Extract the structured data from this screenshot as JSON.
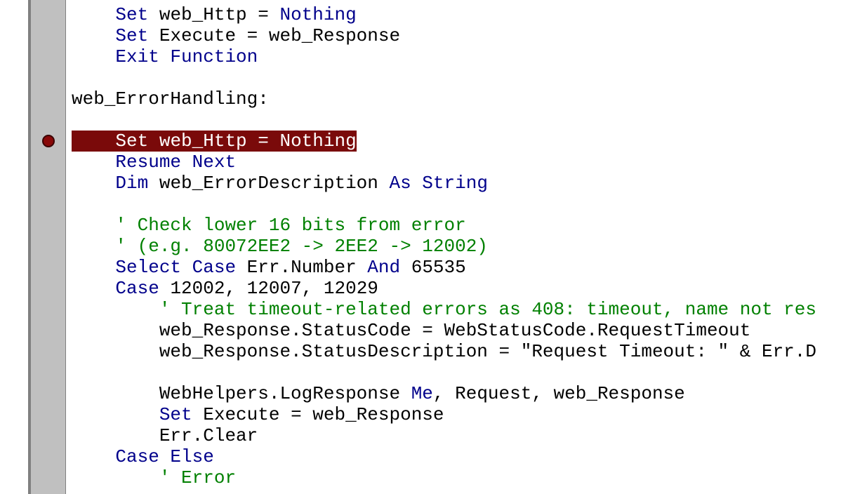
{
  "code": {
    "lines": [
      {
        "indent": 4,
        "highlighted": false,
        "tokens": [
          {
            "cls": "kw",
            "t": "Set"
          },
          {
            "cls": "plain",
            "t": " web_Http = "
          },
          {
            "cls": "kw",
            "t": "Nothing"
          }
        ]
      },
      {
        "indent": 4,
        "highlighted": false,
        "tokens": [
          {
            "cls": "kw",
            "t": "Set"
          },
          {
            "cls": "plain",
            "t": " Execute = web_Response"
          }
        ]
      },
      {
        "indent": 4,
        "highlighted": false,
        "tokens": [
          {
            "cls": "kw",
            "t": "Exit Function"
          }
        ]
      },
      {
        "indent": 0,
        "highlighted": false,
        "tokens": []
      },
      {
        "indent": 0,
        "highlighted": false,
        "tokens": [
          {
            "cls": "plain",
            "t": "web_ErrorHandling:"
          }
        ]
      },
      {
        "indent": 0,
        "highlighted": false,
        "tokens": []
      },
      {
        "indent": 0,
        "highlighted": true,
        "breakpoint": true,
        "tokens": [
          {
            "cls": "plain",
            "t": "    "
          },
          {
            "cls": "kw",
            "t": "Set"
          },
          {
            "cls": "plain",
            "t": " web_Http = "
          },
          {
            "cls": "kw",
            "t": "Nothing"
          }
        ]
      },
      {
        "indent": 4,
        "highlighted": false,
        "tokens": [
          {
            "cls": "kw",
            "t": "Resume"
          },
          {
            "cls": "plain",
            "t": " "
          },
          {
            "cls": "kw",
            "t": "Next"
          }
        ]
      },
      {
        "indent": 4,
        "highlighted": false,
        "tokens": [
          {
            "cls": "kw",
            "t": "Dim"
          },
          {
            "cls": "plain",
            "t": " web_ErrorDescription "
          },
          {
            "cls": "kw",
            "t": "As String"
          }
        ]
      },
      {
        "indent": 0,
        "highlighted": false,
        "tokens": []
      },
      {
        "indent": 4,
        "highlighted": false,
        "tokens": [
          {
            "cls": "cm",
            "t": "' Check lower 16 bits from error"
          }
        ]
      },
      {
        "indent": 4,
        "highlighted": false,
        "tokens": [
          {
            "cls": "cm",
            "t": "' (e.g. 80072EE2 -> 2EE2 -> 12002)"
          }
        ]
      },
      {
        "indent": 4,
        "highlighted": false,
        "tokens": [
          {
            "cls": "kw",
            "t": "Select Case"
          },
          {
            "cls": "plain",
            "t": " Err.Number "
          },
          {
            "cls": "kw",
            "t": "And"
          },
          {
            "cls": "plain",
            "t": " 65535"
          }
        ]
      },
      {
        "indent": 4,
        "highlighted": false,
        "tokens": [
          {
            "cls": "kw",
            "t": "Case"
          },
          {
            "cls": "plain",
            "t": " 12002, 12007, 12029"
          }
        ]
      },
      {
        "indent": 8,
        "highlighted": false,
        "tokens": [
          {
            "cls": "cm",
            "t": "' Treat timeout-related errors as 408: timeout, name not res"
          }
        ]
      },
      {
        "indent": 8,
        "highlighted": false,
        "tokens": [
          {
            "cls": "plain",
            "t": "web_Response.StatusCode = WebStatusCode.RequestTimeout"
          }
        ]
      },
      {
        "indent": 8,
        "highlighted": false,
        "tokens": [
          {
            "cls": "plain",
            "t": "web_Response.StatusDescription = \"Request Timeout: \" & Err.D"
          }
        ]
      },
      {
        "indent": 0,
        "highlighted": false,
        "tokens": []
      },
      {
        "indent": 8,
        "highlighted": false,
        "tokens": [
          {
            "cls": "plain",
            "t": "WebHelpers.LogResponse "
          },
          {
            "cls": "kw",
            "t": "Me"
          },
          {
            "cls": "plain",
            "t": ", Request, web_Response"
          }
        ]
      },
      {
        "indent": 8,
        "highlighted": false,
        "tokens": [
          {
            "cls": "kw",
            "t": "Set"
          },
          {
            "cls": "plain",
            "t": " Execute = web_Response"
          }
        ]
      },
      {
        "indent": 8,
        "highlighted": false,
        "tokens": [
          {
            "cls": "plain",
            "t": "Err.Clear"
          }
        ]
      },
      {
        "indent": 4,
        "highlighted": false,
        "tokens": [
          {
            "cls": "kw",
            "t": "Case Else"
          }
        ]
      },
      {
        "indent": 8,
        "highlighted": false,
        "tokens": [
          {
            "cls": "cm",
            "t": "' Error"
          }
        ]
      }
    ]
  },
  "colors": {
    "keyword": "#00008b",
    "comment": "#008000",
    "highlight_bg": "#7a0a0a",
    "highlight_fg": "#ffffff",
    "breakpoint": "#880808"
  }
}
